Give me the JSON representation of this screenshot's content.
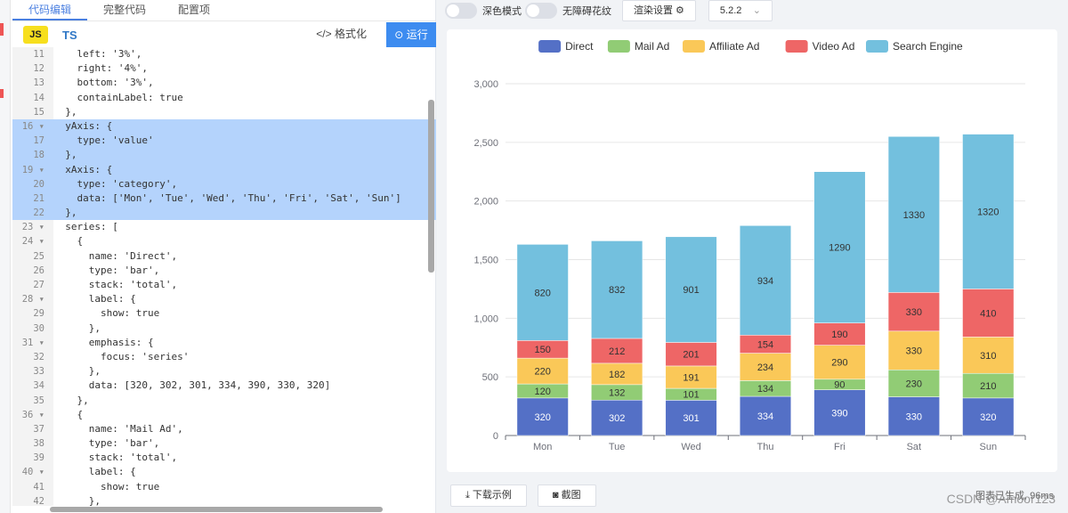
{
  "tabs": [
    {
      "label": "代码编辑",
      "active": true
    },
    {
      "label": "完整代码",
      "active": false
    },
    {
      "label": "配置项",
      "active": false
    }
  ],
  "editor": {
    "js_label": "JS",
    "ts_label": "TS",
    "format_label": "格式化",
    "format_icon": "</>",
    "run_label": "运行",
    "lines": [
      {
        "n": "11",
        "text": "    left: '3%',",
        "sel": false
      },
      {
        "n": "12",
        "text": "    right: '4%',",
        "sel": false
      },
      {
        "n": "13",
        "text": "    bottom: '3%',",
        "sel": false
      },
      {
        "n": "14",
        "text": "    containLabel: true",
        "sel": false
      },
      {
        "n": "15",
        "text": "  },",
        "sel": false
      },
      {
        "n": "16 ▾",
        "text": "  yAxis: {",
        "sel": true
      },
      {
        "n": "17",
        "text": "    type: 'value'",
        "sel": true
      },
      {
        "n": "18",
        "text": "  },",
        "sel": true
      },
      {
        "n": "19 ▾",
        "text": "  xAxis: {",
        "sel": true
      },
      {
        "n": "20",
        "text": "    type: 'category',",
        "sel": true
      },
      {
        "n": "21",
        "text": "    data: ['Mon', 'Tue', 'Wed', 'Thu', 'Fri', 'Sat', 'Sun']",
        "sel": true
      },
      {
        "n": "22",
        "text": "  },",
        "sel": true
      },
      {
        "n": "23 ▾",
        "text": "  series: [",
        "sel": false
      },
      {
        "n": "24 ▾",
        "text": "    {",
        "sel": false
      },
      {
        "n": "25",
        "text": "      name: 'Direct',",
        "sel": false
      },
      {
        "n": "26",
        "text": "      type: 'bar',",
        "sel": false
      },
      {
        "n": "27",
        "text": "      stack: 'total',",
        "sel": false
      },
      {
        "n": "28 ▾",
        "text": "      label: {",
        "sel": false
      },
      {
        "n": "29",
        "text": "        show: true",
        "sel": false
      },
      {
        "n": "30",
        "text": "      },",
        "sel": false
      },
      {
        "n": "31 ▾",
        "text": "      emphasis: {",
        "sel": false
      },
      {
        "n": "32",
        "text": "        focus: 'series'",
        "sel": false
      },
      {
        "n": "33",
        "text": "      },",
        "sel": false
      },
      {
        "n": "34",
        "text": "      data: [320, 302, 301, 334, 390, 330, 320]",
        "sel": false
      },
      {
        "n": "35",
        "text": "    },",
        "sel": false
      },
      {
        "n": "36 ▾",
        "text": "    {",
        "sel": false
      },
      {
        "n": "37",
        "text": "      name: 'Mail Ad',",
        "sel": false
      },
      {
        "n": "38",
        "text": "      type: 'bar',",
        "sel": false
      },
      {
        "n": "39",
        "text": "      stack: 'total',",
        "sel": false
      },
      {
        "n": "40 ▾",
        "text": "      label: {",
        "sel": false
      },
      {
        "n": "41",
        "text": "        show: true",
        "sel": false
      },
      {
        "n": "42",
        "text": "      },",
        "sel": false
      }
    ]
  },
  "toolbar": {
    "dark_label": "深色模式",
    "aria_label": "无障碍花纹",
    "render_label": "渲染设置 ⚙",
    "version": "5.2.2",
    "version_chevron": "⌄"
  },
  "bottom": {
    "download_label": "⤓  下载示例",
    "screenshot_label": "◙  截图",
    "status": "图表已生成, 96ms"
  },
  "watermark": "CSDN @Amoor123",
  "chart_data": {
    "type": "bar",
    "stacked": true,
    "categories": [
      "Mon",
      "Tue",
      "Wed",
      "Thu",
      "Fri",
      "Sat",
      "Sun"
    ],
    "ylim": [
      0,
      3000
    ],
    "yticks": [
      "0",
      "500",
      "1,000",
      "1,500",
      "2,000",
      "2,500",
      "3,000"
    ],
    "ytick_values": [
      0,
      500,
      1000,
      1500,
      2000,
      2500,
      3000
    ],
    "legend_position": "top",
    "grid": true,
    "series": [
      {
        "name": "Direct",
        "color": "#5470c6",
        "values": [
          320,
          302,
          301,
          334,
          390,
          330,
          320
        ]
      },
      {
        "name": "Mail Ad",
        "color": "#91cc75",
        "values": [
          120,
          132,
          101,
          134,
          90,
          230,
          210
        ]
      },
      {
        "name": "Affiliate Ad",
        "color": "#fac858",
        "values": [
          220,
          182,
          191,
          234,
          290,
          330,
          310
        ]
      },
      {
        "name": "Video Ad",
        "color": "#ee6666",
        "values": [
          150,
          212,
          201,
          154,
          190,
          330,
          410
        ]
      },
      {
        "name": "Search Engine",
        "color": "#73c0de",
        "values": [
          820,
          832,
          901,
          934,
          1290,
          1330,
          1320
        ]
      }
    ]
  }
}
